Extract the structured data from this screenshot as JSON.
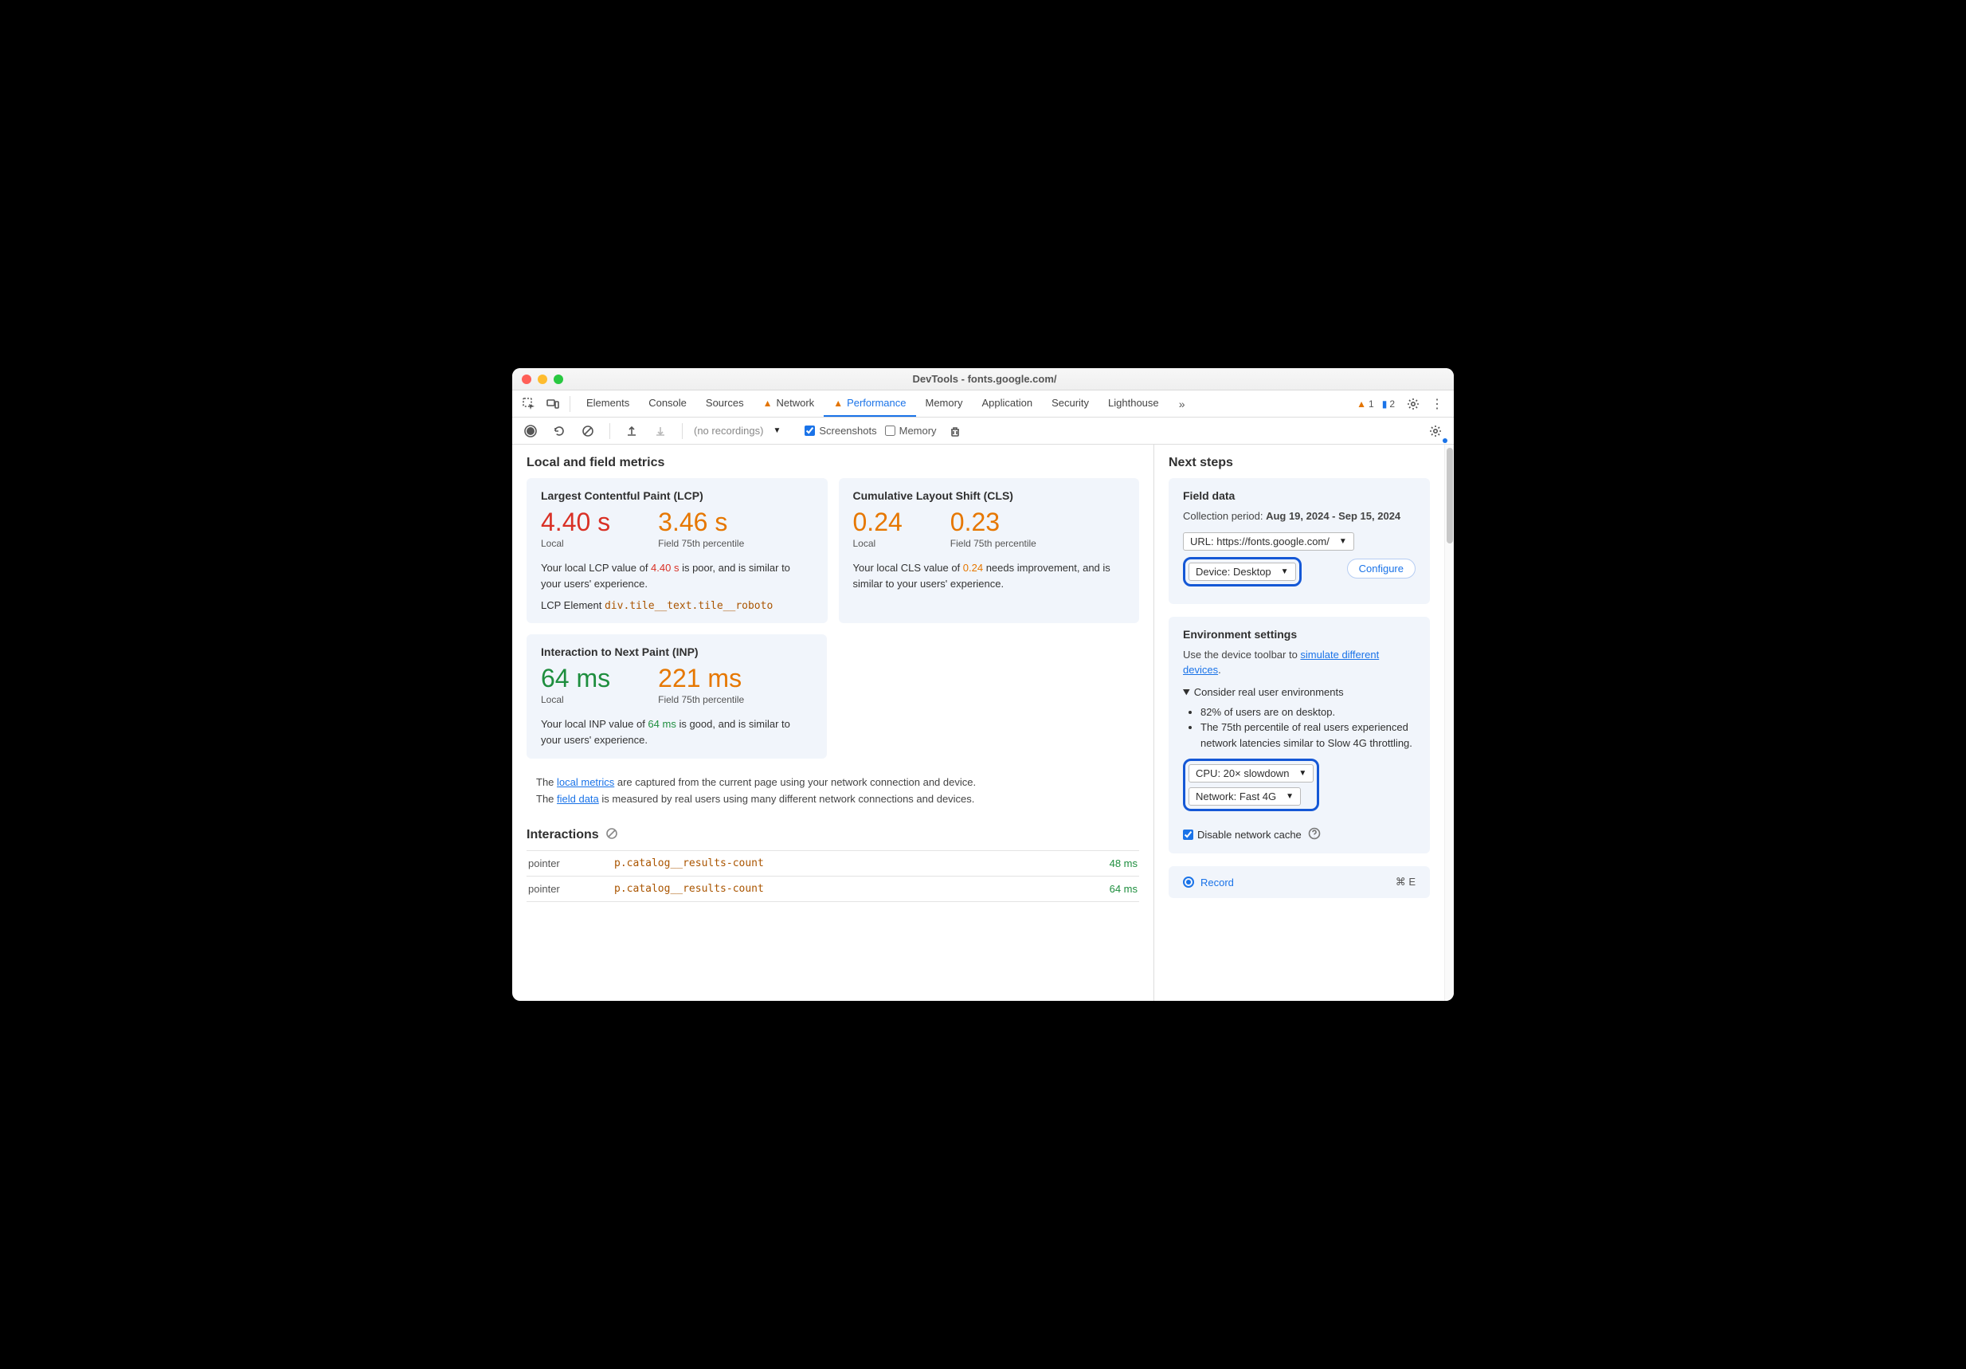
{
  "window": {
    "title": "DevTools - fonts.google.com/"
  },
  "tabs": {
    "items": [
      {
        "label": "Elements",
        "warn": false
      },
      {
        "label": "Console",
        "warn": false
      },
      {
        "label": "Sources",
        "warn": false
      },
      {
        "label": "Network",
        "warn": true
      },
      {
        "label": "Performance",
        "warn": true,
        "active": true
      },
      {
        "label": "Memory",
        "warn": false
      },
      {
        "label": "Application",
        "warn": false
      },
      {
        "label": "Security",
        "warn": false
      },
      {
        "label": "Lighthouse",
        "warn": false
      }
    ],
    "issues_warn": "1",
    "issues_info": "2"
  },
  "toolbar": {
    "recordings_placeholder": "(no recordings)",
    "screenshots": "Screenshots",
    "memory": "Memory"
  },
  "main": {
    "heading": "Local and field metrics",
    "lcp": {
      "title": "Largest Contentful Paint (LCP)",
      "local_value": "4.40 s",
      "local_label": "Local",
      "field_value": "3.46 s",
      "field_label": "Field 75th percentile",
      "desc_pre": "Your local LCP value of ",
      "desc_val": "4.40 s",
      "desc_post": " is poor, and is similar to your users' experience.",
      "elem_label": "LCP Element  ",
      "elem_sel": "div.tile__text.tile__roboto"
    },
    "cls": {
      "title": "Cumulative Layout Shift (CLS)",
      "local_value": "0.24",
      "local_label": "Local",
      "field_value": "0.23",
      "field_label": "Field 75th percentile",
      "desc_pre": "Your local CLS value of ",
      "desc_val": "0.24",
      "desc_post": " needs improvement, and is similar to your users' experience."
    },
    "inp": {
      "title": "Interaction to Next Paint (INP)",
      "local_value": "64 ms",
      "local_label": "Local",
      "field_value": "221 ms",
      "field_label": "Field 75th percentile",
      "desc_pre": "Your local INP value of ",
      "desc_val": "64 ms",
      "desc_post": " is good, and is similar to your users' experience."
    },
    "note": {
      "line1_pre": "The ",
      "line1_link": "local metrics",
      "line1_post": " are captured from the current page using your network connection and device.",
      "line2_pre": "The ",
      "line2_link": "field data",
      "line2_post": " is measured by real users using many different network connections and devices."
    },
    "interactions": {
      "heading": "Interactions",
      "rows": [
        {
          "type": "pointer",
          "selector": "p.catalog__results-count",
          "time": "48 ms"
        },
        {
          "type": "pointer",
          "selector": "p.catalog__results-count",
          "time": "64 ms"
        }
      ]
    }
  },
  "side": {
    "heading": "Next steps",
    "field": {
      "title": "Field data",
      "period_label": "Collection period: ",
      "period_value": "Aug 19, 2024 - Sep 15, 2024",
      "url_select": "URL: https://fonts.google.com/",
      "device_select": "Device: Desktop",
      "configure": "Configure"
    },
    "env": {
      "title": "Environment settings",
      "hint_pre": "Use the device toolbar to ",
      "hint_link": "simulate different devices",
      "hint_post": ".",
      "details_summary": "Consider real user environments",
      "bullets": [
        "82% of users are on desktop.",
        "The 75th percentile of real users experienced network latencies similar to Slow 4G throttling."
      ],
      "cpu_select": "CPU: 20× slowdown",
      "net_select": "Network: Fast 4G",
      "disable_cache": "Disable network cache"
    },
    "record": {
      "label": "Record",
      "kb": "⌘ E"
    }
  }
}
